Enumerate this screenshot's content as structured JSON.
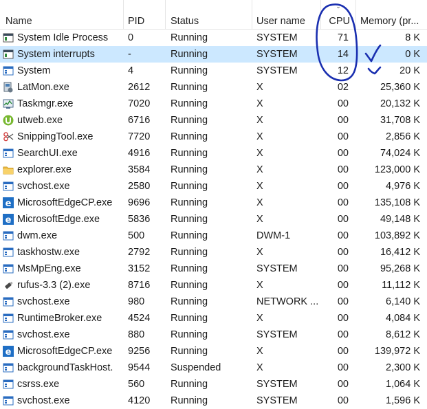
{
  "columns": {
    "name": "Name",
    "pid": "PID",
    "status": "Status",
    "user": "User name",
    "cpu": "CPU",
    "memory": "Memory (pr..."
  },
  "rows": [
    {
      "name": "System Idle Process",
      "pid": "0",
      "status": "Running",
      "user": "SYSTEM",
      "cpu": "71",
      "memory": "8 K",
      "icon": "window-icon"
    },
    {
      "name": "System interrupts",
      "pid": "-",
      "status": "Running",
      "user": "SYSTEM",
      "cpu": "14",
      "memory": "0 K",
      "icon": "window-icon",
      "selected": true
    },
    {
      "name": "System",
      "pid": "4",
      "status": "Running",
      "user": "SYSTEM",
      "cpu": "12",
      "memory": "20 K",
      "icon": "blue-window-icon"
    },
    {
      "name": "LatMon.exe",
      "pid": "2612",
      "status": "Running",
      "user": "X",
      "cpu": "02",
      "memory": "25,360 K",
      "icon": "latmon-icon"
    },
    {
      "name": "Taskmgr.exe",
      "pid": "7020",
      "status": "Running",
      "user": "X",
      "cpu": "00",
      "memory": "20,132 K",
      "icon": "task-manager-icon"
    },
    {
      "name": "utweb.exe",
      "pid": "6716",
      "status": "Running",
      "user": "X",
      "cpu": "00",
      "memory": "31,708 K",
      "icon": "utorrent-icon"
    },
    {
      "name": "SnippingTool.exe",
      "pid": "7720",
      "status": "Running",
      "user": "X",
      "cpu": "00",
      "memory": "2,856 K",
      "icon": "scissors-icon"
    },
    {
      "name": "SearchUI.exe",
      "pid": "4916",
      "status": "Running",
      "user": "X",
      "cpu": "00",
      "memory": "74,024 K",
      "icon": "blue-window-icon"
    },
    {
      "name": "explorer.exe",
      "pid": "3584",
      "status": "Running",
      "user": "X",
      "cpu": "00",
      "memory": "123,000 K",
      "icon": "folder-icon"
    },
    {
      "name": "svchost.exe",
      "pid": "2580",
      "status": "Running",
      "user": "X",
      "cpu": "00",
      "memory": "4,976 K",
      "icon": "blue-window-icon"
    },
    {
      "name": "MicrosoftEdgeCP.exe",
      "pid": "9696",
      "status": "Running",
      "user": "X",
      "cpu": "00",
      "memory": "135,108 K",
      "icon": "edge-icon"
    },
    {
      "name": "MicrosoftEdge.exe",
      "pid": "5836",
      "status": "Running",
      "user": "X",
      "cpu": "00",
      "memory": "49,148 K",
      "icon": "edge-icon"
    },
    {
      "name": "dwm.exe",
      "pid": "500",
      "status": "Running",
      "user": "DWM-1",
      "cpu": "00",
      "memory": "103,892 K",
      "icon": "blue-window-icon"
    },
    {
      "name": "taskhostw.exe",
      "pid": "2792",
      "status": "Running",
      "user": "X",
      "cpu": "00",
      "memory": "16,412 K",
      "icon": "blue-window-icon"
    },
    {
      "name": "MsMpEng.exe",
      "pid": "3152",
      "status": "Running",
      "user": "SYSTEM",
      "cpu": "00",
      "memory": "95,268 K",
      "icon": "blue-window-icon"
    },
    {
      "name": "rufus-3.3 (2).exe",
      "pid": "8716",
      "status": "Running",
      "user": "X",
      "cpu": "00",
      "memory": "11,112 K",
      "icon": "usb-drive-icon"
    },
    {
      "name": "svchost.exe",
      "pid": "980",
      "status": "Running",
      "user": "NETWORK ...",
      "cpu": "00",
      "memory": "6,140 K",
      "icon": "blue-window-icon"
    },
    {
      "name": "RuntimeBroker.exe",
      "pid": "4524",
      "status": "Running",
      "user": "X",
      "cpu": "00",
      "memory": "4,084 K",
      "icon": "blue-window-icon"
    },
    {
      "name": "svchost.exe",
      "pid": "880",
      "status": "Running",
      "user": "SYSTEM",
      "cpu": "00",
      "memory": "8,612 K",
      "icon": "blue-window-icon"
    },
    {
      "name": "MicrosoftEdgeCP.exe",
      "pid": "9256",
      "status": "Running",
      "user": "X",
      "cpu": "00",
      "memory": "139,972 K",
      "icon": "edge-icon"
    },
    {
      "name": "backgroundTaskHost.",
      "pid": "9544",
      "status": "Suspended",
      "user": "X",
      "cpu": "00",
      "memory": "2,300 K",
      "icon": "blue-window-icon"
    },
    {
      "name": "csrss.exe",
      "pid": "560",
      "status": "Running",
      "user": "SYSTEM",
      "cpu": "00",
      "memory": "1,064 K",
      "icon": "blue-window-icon"
    },
    {
      "name": "svchost.exe",
      "pid": "4120",
      "status": "Running",
      "user": "SYSTEM",
      "cpu": "00",
      "memory": "1,596 K",
      "icon": "blue-window-icon"
    }
  ],
  "colors": {
    "selection": "#cce8ff",
    "annotation_ink": "#1a2fb0",
    "icon_blue": "#1f6fc5"
  }
}
